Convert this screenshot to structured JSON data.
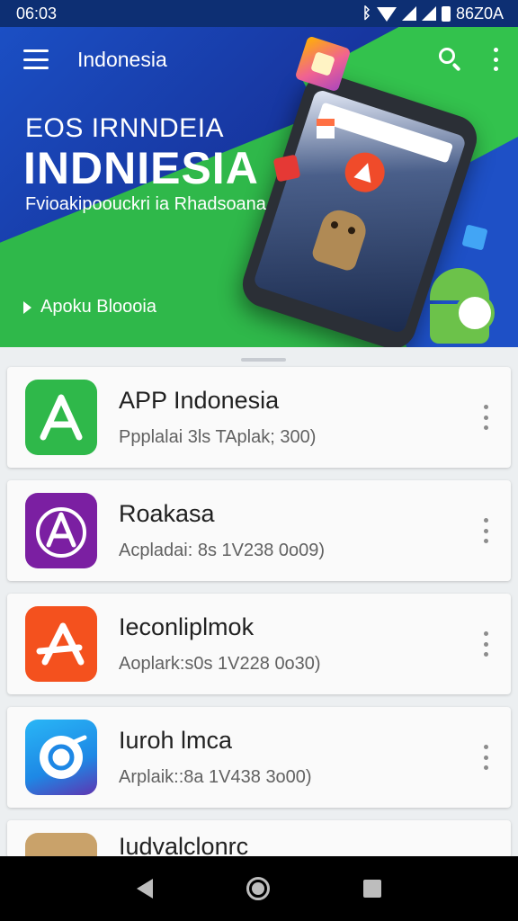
{
  "status_bar": {
    "time": "06:03",
    "right_text": "86Z0A"
  },
  "app_bar": {
    "title": "Indonesia"
  },
  "banner": {
    "kicker": "EOS IRNNDEIA",
    "title": "INDNIESIA",
    "subtitle": "Fvioakipoouckri ia Rhadsoana",
    "cta_label": "Apoku Bloooia"
  },
  "apps": [
    {
      "name": "APP Indonesia",
      "subtitle": "Ppplalai 3ls  TAplak; 300)",
      "icon": "a-logo-green-icon",
      "color": "#2fb84a"
    },
    {
      "name": "Roakasa",
      "subtitle": "Acpladai: 8s  1V238  0o09)",
      "icon": "a-logo-purple-icon",
      "color": "#7b1fa2"
    },
    {
      "name": "Ieconliplmok",
      "subtitle": "Aoplark:s0s  1V228  0o30)",
      "icon": "a-logo-red-icon",
      "color": "#f4511e"
    },
    {
      "name": "Iuroh lmca",
      "subtitle": "Arplaik::8a  1V438  3o00)",
      "icon": "compass-blue-icon",
      "color": "#1e88e5"
    },
    {
      "name": "Iudvalclonrc",
      "subtitle": "",
      "icon": "house-tan-icon",
      "color": "#c9a26a"
    }
  ],
  "nav": {
    "back": "back-icon",
    "home": "home-icon",
    "recents": "recents-icon"
  }
}
